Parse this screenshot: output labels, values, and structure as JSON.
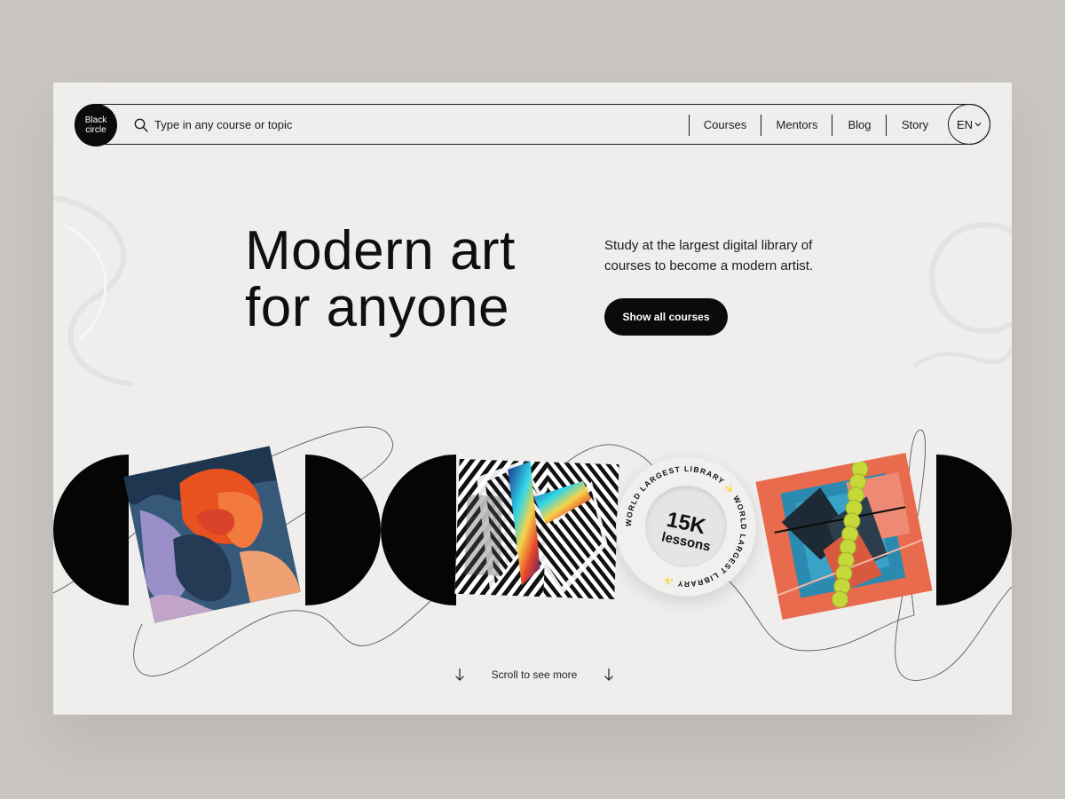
{
  "brand": {
    "logo_text": "Black circle"
  },
  "search": {
    "placeholder": "Type in any course or topic"
  },
  "nav": {
    "items": [
      {
        "label": "Courses"
      },
      {
        "label": "Mentors"
      },
      {
        "label": "Blog"
      },
      {
        "label": "Story"
      }
    ],
    "language": "EN"
  },
  "hero": {
    "title_line1": "Modern art",
    "title_line2": "for anyone",
    "subtitle": "Study at the largest digital library of courses to become a modern artist.",
    "cta_label": "Show all courses"
  },
  "badge": {
    "ring_text": "WORLD LARGEST LIBRARY ✨ WORLD LARGEST LIBRARY ✨",
    "count": "15K",
    "unit": "lessons"
  },
  "scroll": {
    "label": "Scroll to see more"
  },
  "colors": {
    "background": "#efeeec",
    "ink": "#0b0b0b",
    "accent_orange": "#f26b2b"
  }
}
